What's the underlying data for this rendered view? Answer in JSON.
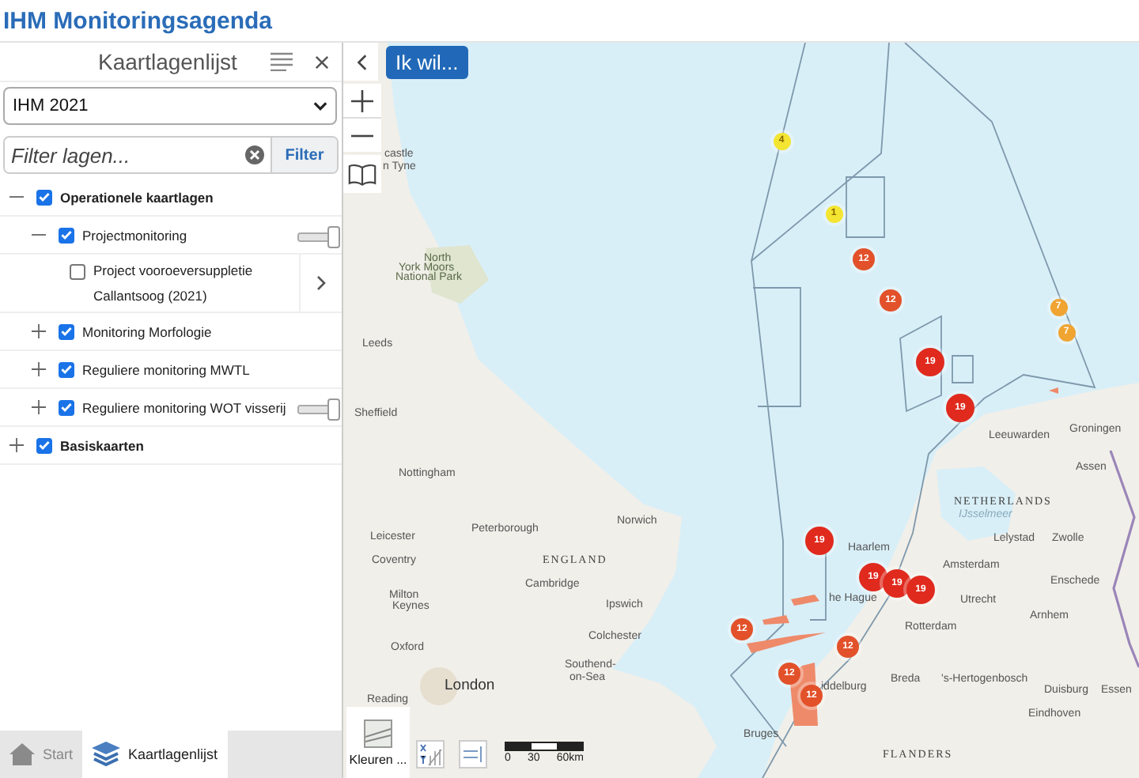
{
  "app": {
    "title": "IHM Monitoringsagenda"
  },
  "panel": {
    "title": "Kaartlagenlijst",
    "select_value": "IHM 2021",
    "filter": {
      "placeholder": "Filter lagen...",
      "button": "Filter"
    },
    "layers": [
      {
        "kind": "group",
        "label": "Operationele kaartlagen",
        "checked": true,
        "expanded": true,
        "children": [
          {
            "kind": "group",
            "label": "Projectmonitoring",
            "checked": true,
            "expanded": true,
            "level": 1,
            "children": [
              {
                "kind": "layer",
                "label": "Project vooroeversuppletie Callantsoog (2021)",
                "checked": false
              }
            ]
          },
          {
            "kind": "group",
            "label": "Monitoring Morfologie",
            "checked": true,
            "expanded": false
          },
          {
            "kind": "group",
            "label": "Reguliere monitoring MWTL",
            "checked": true,
            "expanded": false
          },
          {
            "kind": "group",
            "label": "Reguliere monitoring WOT visserij",
            "checked": true,
            "expanded": false,
            "level": 1
          }
        ]
      },
      {
        "kind": "group",
        "label": "Basiskaarten",
        "checked": true,
        "expanded": false
      }
    ]
  },
  "tabs": [
    {
      "label": "Start",
      "selected": false
    },
    {
      "label": "Kaartlagenlijst",
      "selected": true
    }
  ],
  "map": {
    "action_button": "Ik wil...",
    "basemap_label": "Kleuren ...",
    "scale": [
      "0",
      "30",
      "60km"
    ],
    "labels": [
      "castle",
      "n Tyne",
      "North",
      "York Moors",
      "National Park",
      "Leeds",
      "Sheffield",
      "Nottingham",
      "Leicester",
      "Peterborough",
      "Norwich",
      "Coventry",
      "ENGLAND",
      "Cambridge",
      "Milton",
      "Keynes",
      "Ipswich",
      "Colchester",
      "Oxford",
      "London",
      "Southend-",
      "on-Sea",
      "Reading",
      "Leeuwarden",
      "Groningen",
      "Assen",
      "NETHERLANDS",
      "IJsselmeer",
      "Lelystad",
      "Zwolle",
      "Haarlem",
      "Amsterdam",
      "Enschede",
      "he Hague",
      "Utrecht",
      "Rotterdam",
      "Arnhem",
      "Breda",
      "'s-Hertogenbosch",
      "iddelburg",
      "Duisburg",
      "Essen",
      "Eindhoven",
      "Bruges",
      "FLANDERS"
    ],
    "markers": [
      {
        "count": "4",
        "color": "#f3e531"
      },
      {
        "count": "1",
        "color": "#f3e531"
      },
      {
        "count": "12",
        "color": "#e2512a"
      },
      {
        "count": "12",
        "color": "#e2512a"
      },
      {
        "count": "19",
        "color": "#e02a1e"
      },
      {
        "count": "19",
        "color": "#e02a1e"
      },
      {
        "count": "7",
        "color": "#f0a431"
      },
      {
        "count": "7",
        "color": "#f0a431"
      },
      {
        "count": "19",
        "color": "#e02a1e"
      },
      {
        "count": "19",
        "color": "#e02a1e"
      },
      {
        "count": "19",
        "color": "#e02a1e"
      },
      {
        "count": "19",
        "color": "#e02a1e"
      },
      {
        "count": "12",
        "color": "#e2512a"
      },
      {
        "count": "12",
        "color": "#e2512a"
      },
      {
        "count": "12",
        "color": "#e2512a"
      },
      {
        "count": "12",
        "color": "#e2512a"
      }
    ]
  }
}
